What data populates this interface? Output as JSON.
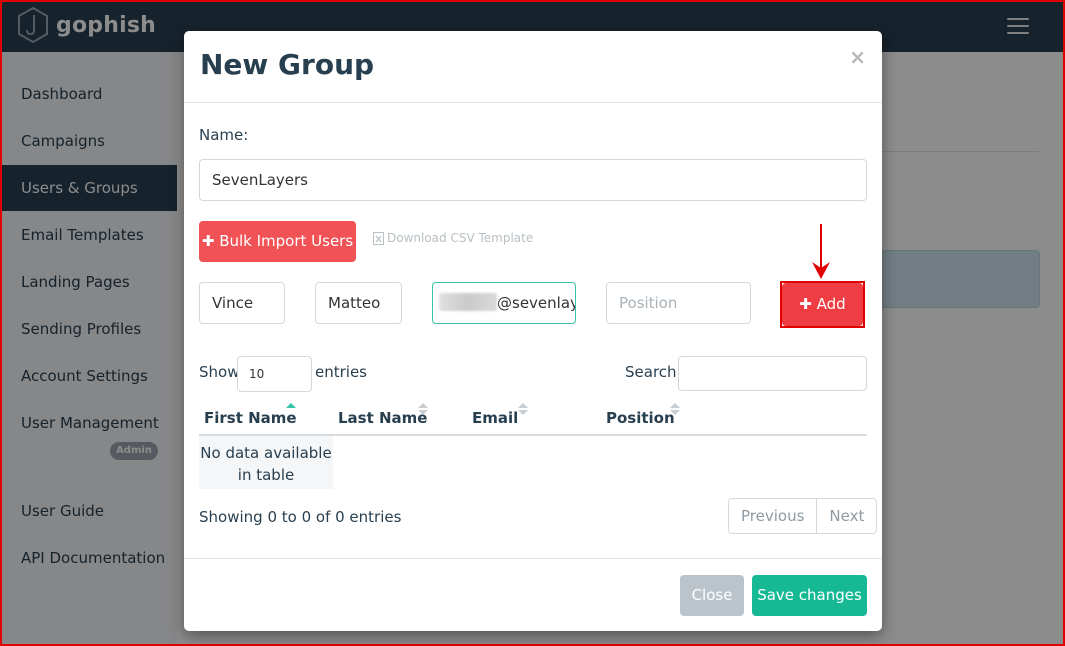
{
  "app": {
    "name": "gophish"
  },
  "sidebar": {
    "items": [
      {
        "label": "Dashboard"
      },
      {
        "label": "Campaigns"
      },
      {
        "label": "Users & Groups"
      },
      {
        "label": "Email Templates"
      },
      {
        "label": "Landing Pages"
      },
      {
        "label": "Sending Profiles"
      },
      {
        "label": "Account Settings"
      },
      {
        "label": "User Management"
      },
      {
        "label": "User Guide"
      },
      {
        "label": "API Documentation"
      }
    ],
    "admin_badge": "Admin"
  },
  "modal": {
    "title": "New Group",
    "close_glyph": "×",
    "name_label": "Name:",
    "name_value": "SevenLayers",
    "bulk_import_label": "Bulk Import Users",
    "csv_template_label": "Download CSV Template",
    "user_form": {
      "first_name": "Vince",
      "last_name": "Matteo",
      "email_visible": "@sevenlay",
      "position_placeholder": "Position",
      "add_label": "Add"
    },
    "table": {
      "show_label": "Show",
      "entries_value": "10",
      "entries_label": "entries",
      "search_label": "Search:",
      "columns": [
        "First Name",
        "Last Name",
        "Email",
        "Position"
      ],
      "empty_message_line1": "No data available",
      "empty_message_line2": "in table",
      "info": "Showing 0 to 0 of 0 entries",
      "prev_label": "Previous",
      "next_label": "Next"
    },
    "footer": {
      "close_label": "Close",
      "save_label": "Save changes"
    }
  },
  "colors": {
    "navbar": "#283f50",
    "danger": "#f05256",
    "primary_teal": "#17b995",
    "annotation_red": "#e00000"
  }
}
